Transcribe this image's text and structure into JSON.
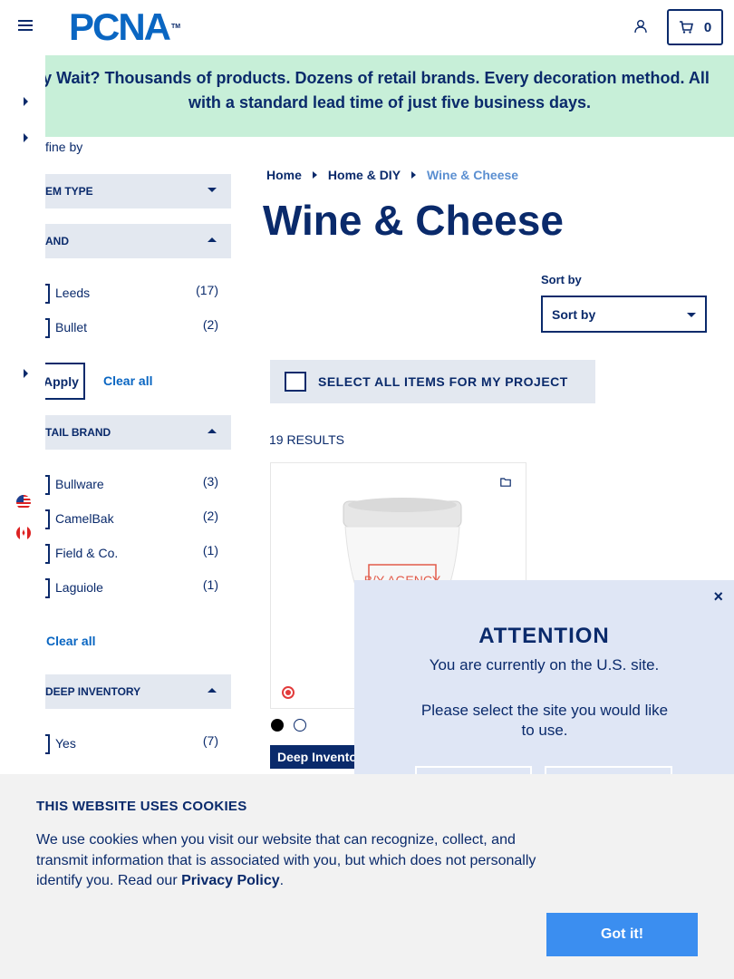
{
  "header": {
    "logo_text": "PCNA",
    "logo_tm": "TM",
    "cart_count": "0"
  },
  "banner": {
    "line1": "y Wait? Thousands of products. Dozens of retail brands. Every decoration method. All",
    "line2": "with a standard lead time of just five business days."
  },
  "sidebar": {
    "refine_label": "fine by",
    "facets": [
      {
        "title": "EM TYPE",
        "expanded": false
      },
      {
        "title": "AND",
        "expanded": true,
        "options": [
          {
            "label": "Leeds",
            "count": "(17)"
          },
          {
            "label": "Bullet",
            "count": "(2)"
          }
        ],
        "apply_label": "Apply",
        "clear_label": "Clear all"
      },
      {
        "title": "TAIL BRAND",
        "expanded": true,
        "options": [
          {
            "label": "Bullware",
            "count": "(3)"
          },
          {
            "label": "CamelBak",
            "count": "(2)"
          },
          {
            "label": "Field & Co.",
            "count": "(1)"
          },
          {
            "label": "Laguiole",
            "count": "(1)"
          }
        ],
        "clear_label": "Clear all"
      },
      {
        "title": "DEEP INVENTORY",
        "expanded": true,
        "options": [
          {
            "label": "Yes",
            "count": "(7)"
          }
        ]
      }
    ]
  },
  "breadcrumb": [
    "Home",
    "Home & DIY",
    "Wine & Cheese"
  ],
  "main": {
    "title": "Wine & Cheese",
    "sort_label": "Sort by",
    "sort_value": "Sort by",
    "select_all": "SELECT ALL ITEMS FOR MY PROJECT",
    "results": "19 RESULTS",
    "product": {
      "swatches": [
        "#000000",
        "#ffffff"
      ],
      "tag": "Deep Inventory"
    }
  },
  "modal": {
    "close": "×",
    "title": "ATTENTION",
    "line1": "You are currently on the U.S. site.",
    "line2": "Please select the site you would like to use."
  },
  "cookie": {
    "title": "THIS WEBSITE USES COOKIES",
    "text": "We use cookies when you visit our website that can recognize, collect, and transmit information that is associated with you, but which does not personally identify you. Read our ",
    "link": "Privacy Policy",
    "period": ".",
    "button": "Got it!"
  },
  "colors": {
    "navy": "#0a2a6b",
    "brand_blue": "#0a66c2",
    "banner_bg": "#c7efd8",
    "button_blue": "#3b8ef0",
    "facet_bg": "#e3e8f0"
  }
}
